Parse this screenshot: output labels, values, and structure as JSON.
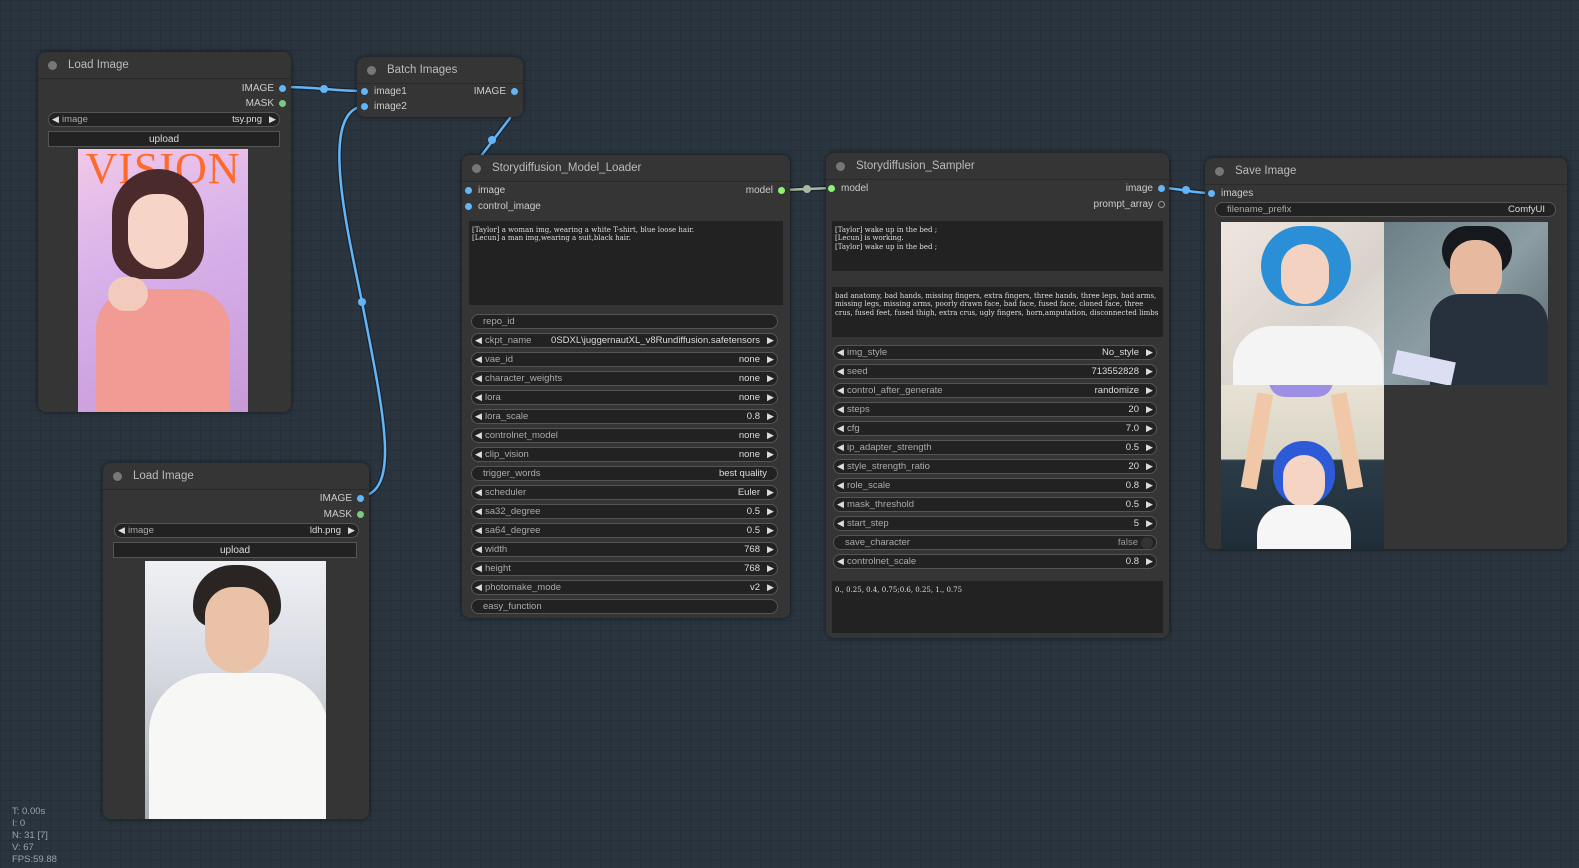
{
  "nodes": {
    "load_image_1": {
      "title": "Load Image",
      "outputs": [
        "IMAGE",
        "MASK"
      ],
      "image_widget": {
        "label": "image",
        "value": "tsy.png"
      },
      "upload_label": "upload",
      "preview": "woman-portrait-pink-dress-vision-cover"
    },
    "load_image_2": {
      "title": "Load Image",
      "outputs": [
        "IMAGE",
        "MASK"
      ],
      "image_widget": {
        "label": "image",
        "value": "ldh.png"
      },
      "upload_label": "upload",
      "preview": "man-portrait-white-suit"
    },
    "batch_images": {
      "title": "Batch Images",
      "inputs": [
        "image1",
        "image2"
      ],
      "outputs": [
        "IMAGE"
      ]
    },
    "model_loader": {
      "title": "Storydiffusion_Model_Loader",
      "inputs": [
        "image",
        "control_image"
      ],
      "outputs": [
        "model"
      ],
      "prompt": "[Taylor] a woman img, wearing a white T-shirt, blue loose hair.\n[Lecun] a man img,wearing a suit,black hair.",
      "widgets": [
        {
          "label": "repo_id",
          "value": "",
          "type": "text"
        },
        {
          "label": "ckpt_name",
          "value": "0SDXL\\juggernautXL_v8Rundiffusion.safetensors",
          "type": "combo"
        },
        {
          "label": "vae_id",
          "value": "none",
          "type": "combo"
        },
        {
          "label": "character_weights",
          "value": "none",
          "type": "combo"
        },
        {
          "label": "lora",
          "value": "none",
          "type": "combo"
        },
        {
          "label": "lora_scale",
          "value": "0.8",
          "type": "number"
        },
        {
          "label": "controlnet_model",
          "value": "none",
          "type": "combo"
        },
        {
          "label": "clip_vision",
          "value": "none",
          "type": "combo"
        },
        {
          "label": "trigger_words",
          "value": "best quality",
          "type": "text"
        },
        {
          "label": "scheduler",
          "value": "Euler",
          "type": "combo"
        },
        {
          "label": "sa32_degree",
          "value": "0.5",
          "type": "number"
        },
        {
          "label": "sa64_degree",
          "value": "0.5",
          "type": "number"
        },
        {
          "label": "width",
          "value": "768",
          "type": "number"
        },
        {
          "label": "height",
          "value": "768",
          "type": "number"
        },
        {
          "label": "photomake_mode",
          "value": "v2",
          "type": "combo"
        },
        {
          "label": "easy_function",
          "value": "",
          "type": "text"
        }
      ]
    },
    "sampler": {
      "title": "Storydiffusion_Sampler",
      "inputs": [
        "model"
      ],
      "outputs": [
        "image",
        "prompt_array"
      ],
      "prompt": "[Taylor] wake up in the bed ;\n[Lecun] is working.\n[Taylor] wake up in the bed ;",
      "negative_prompt": "bad anatomy, bad hands, missing fingers, extra fingers, three hands, three legs, bad arms, missing legs, missing arms, poorly drawn face, bad face, fused face, cloned face, three crus, fused feet, fused thigh, extra crus, ugly fingers, horn,amputation, disconnected limbs",
      "widgets": [
        {
          "label": "img_style",
          "value": "No_style",
          "type": "combo"
        },
        {
          "label": "seed",
          "value": "713552828",
          "type": "number"
        },
        {
          "label": "control_after_generate",
          "value": "randomize",
          "type": "combo"
        },
        {
          "label": "steps",
          "value": "20",
          "type": "number"
        },
        {
          "label": "cfg",
          "value": "7.0",
          "type": "number"
        },
        {
          "label": "ip_adapter_strength",
          "value": "0.5",
          "type": "number"
        },
        {
          "label": "style_strength_ratio",
          "value": "20",
          "type": "number"
        },
        {
          "label": "role_scale",
          "value": "0.8",
          "type": "number"
        },
        {
          "label": "mask_threshold",
          "value": "0.5",
          "type": "number"
        },
        {
          "label": "start_step",
          "value": "5",
          "type": "number"
        },
        {
          "label": "save_character",
          "value": "false",
          "type": "toggle"
        },
        {
          "label": "controlnet_scale",
          "value": "0.8",
          "type": "number"
        }
      ],
      "mask_coords": "0., 0.25, 0.4, 0.75;0.6, 0.25, 1., 0.75"
    },
    "save_image": {
      "title": "Save Image",
      "inputs": [
        "images"
      ],
      "filename_prefix": {
        "label": "filename_prefix",
        "value": "ComfyUI"
      },
      "previews": [
        "woman-blue-hair-in-bed",
        "man-in-suit-working",
        "woman-blue-hair-arms-raised"
      ]
    }
  },
  "stats": {
    "time": "T: 0.00s",
    "iterations": "I: 0",
    "nodes": "N: 31 [7]",
    "vertices": "V: 67",
    "fps": "FPS:59.88"
  },
  "colors": {
    "image_link": "#64b5f6",
    "model_link": "#a8b8a0",
    "model_slot": "#8df273",
    "mask_slot": "#81c784"
  }
}
